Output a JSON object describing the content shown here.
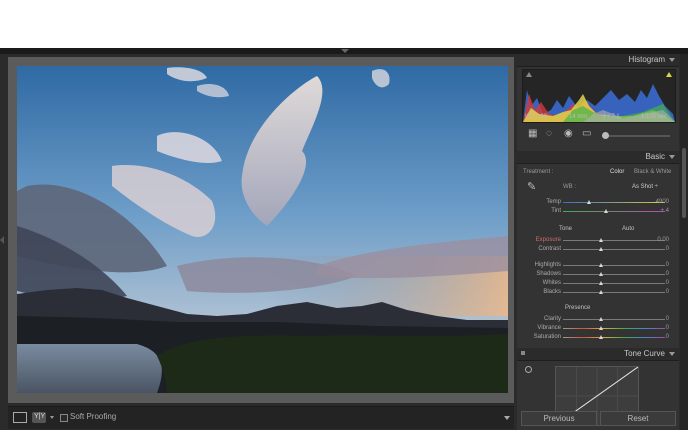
{
  "center_toolbar": {
    "loupe_icon": "loupe-view-icon",
    "compare_label": "Y|Y",
    "soft_proofing_label": "Soft Proofing"
  },
  "histogram": {
    "title": "Histogram",
    "iso": "ISO 100",
    "focal": "14 mm",
    "aperture": "ƒ / 7.1",
    "shutter": "1/100 sec"
  },
  "basic": {
    "title": "Basic",
    "treatment_label": "Treatment :",
    "treatment_color": "Color",
    "treatment_bw": "Black & White",
    "wb_label": "WB :",
    "wb_value": "As Shot ÷",
    "temp_label": "Temp",
    "temp_value": "4900",
    "tint_label": "Tint",
    "tint_value": "+ 4",
    "tone_label": "Tone",
    "auto_label": "Auto",
    "exposure_label": "Exposure",
    "exposure_value": "0.00",
    "contrast_label": "Contrast",
    "contrast_value": "0",
    "highlights_label": "Highlights",
    "highlights_value": "0",
    "shadows_label": "Shadows",
    "shadows_value": "0",
    "whites_label": "Whites",
    "whites_value": "0",
    "blacks_label": "Blacks",
    "blacks_value": "0",
    "presence_label": "Presence",
    "clarity_label": "Clarity",
    "clarity_value": "0",
    "vibrance_label": "Vibrance",
    "vibrance_value": "0",
    "saturation_label": "Saturation",
    "saturation_value": "0"
  },
  "tone_curve": {
    "title": "Tone Curve"
  },
  "buttons": {
    "previous": "Previous",
    "reset": "Reset"
  }
}
